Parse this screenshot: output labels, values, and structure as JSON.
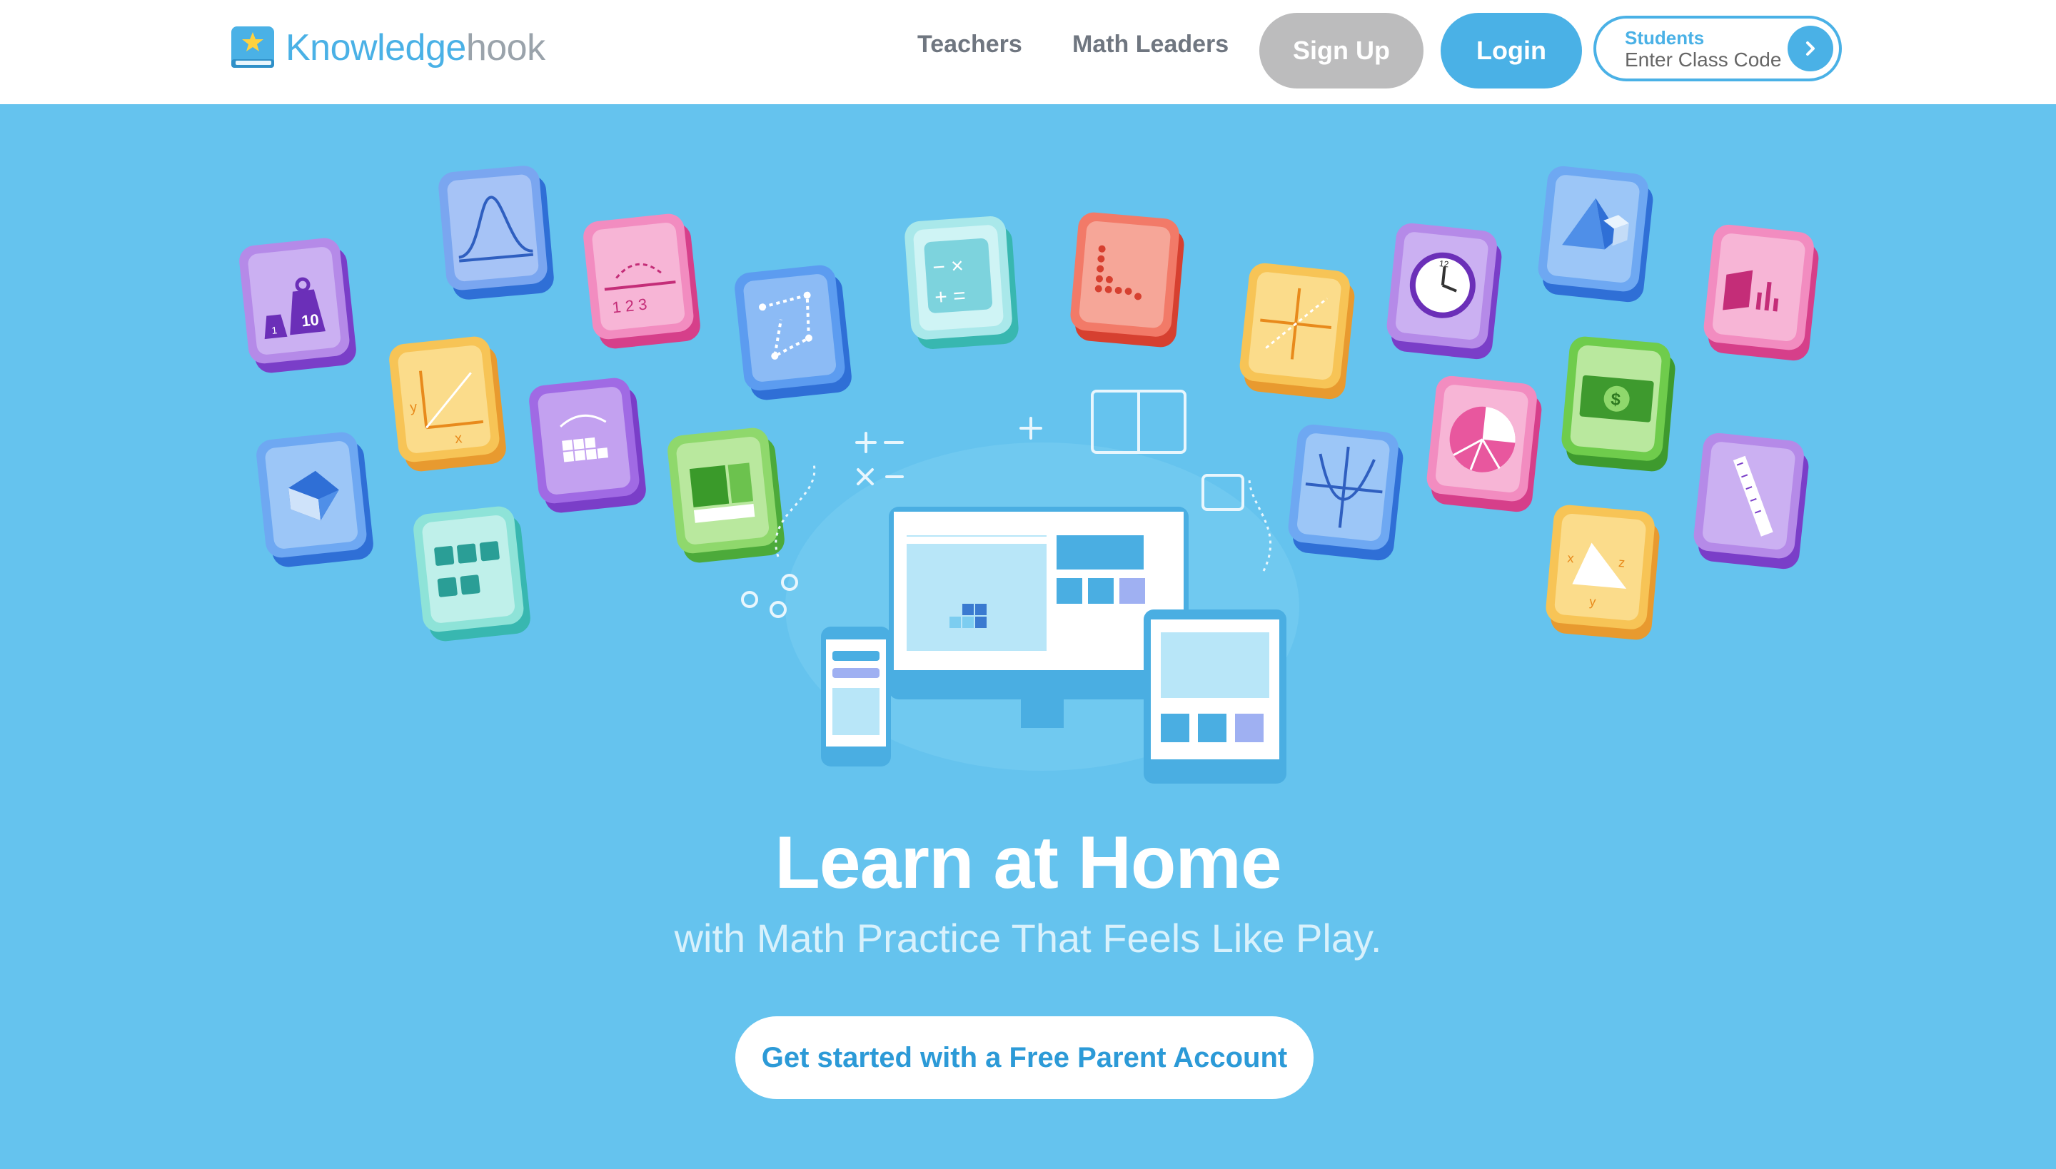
{
  "header": {
    "logo": {
      "part1": "Knowledge",
      "part2": "hook"
    },
    "nav": {
      "teachers": "Teachers",
      "math_leaders": "Math Leaders"
    },
    "sign_up": "Sign Up",
    "login": "Login",
    "students": {
      "label": "Students",
      "placeholder": "Enter Class Code"
    }
  },
  "hero": {
    "title": "Learn at Home",
    "subtitle": "with Math Practice That Feels Like Play.",
    "cta": "Get started with a Free Parent Account"
  },
  "colors": {
    "brand_blue": "#4ab1e6",
    "hero_bg": "#65c3ee",
    "signup_gray": "#bcbcbd"
  },
  "tile_icons": [
    "weight-scale-icon",
    "bell-curve-icon",
    "number-line-icon",
    "polygon-icon",
    "calculator-icon",
    "dot-plot-icon",
    "coordinate-axes-icon",
    "clock-icon",
    "cube-prism-icon",
    "bar-graph-icon",
    "graph-xy-icon",
    "fraction-grid-icon",
    "area-model-icon",
    "parabola-icon",
    "pie-chart-icon",
    "money-icon",
    "ruler-icon",
    "prism-icon",
    "integer-tiles-icon",
    "triangle-xyz-icon"
  ]
}
